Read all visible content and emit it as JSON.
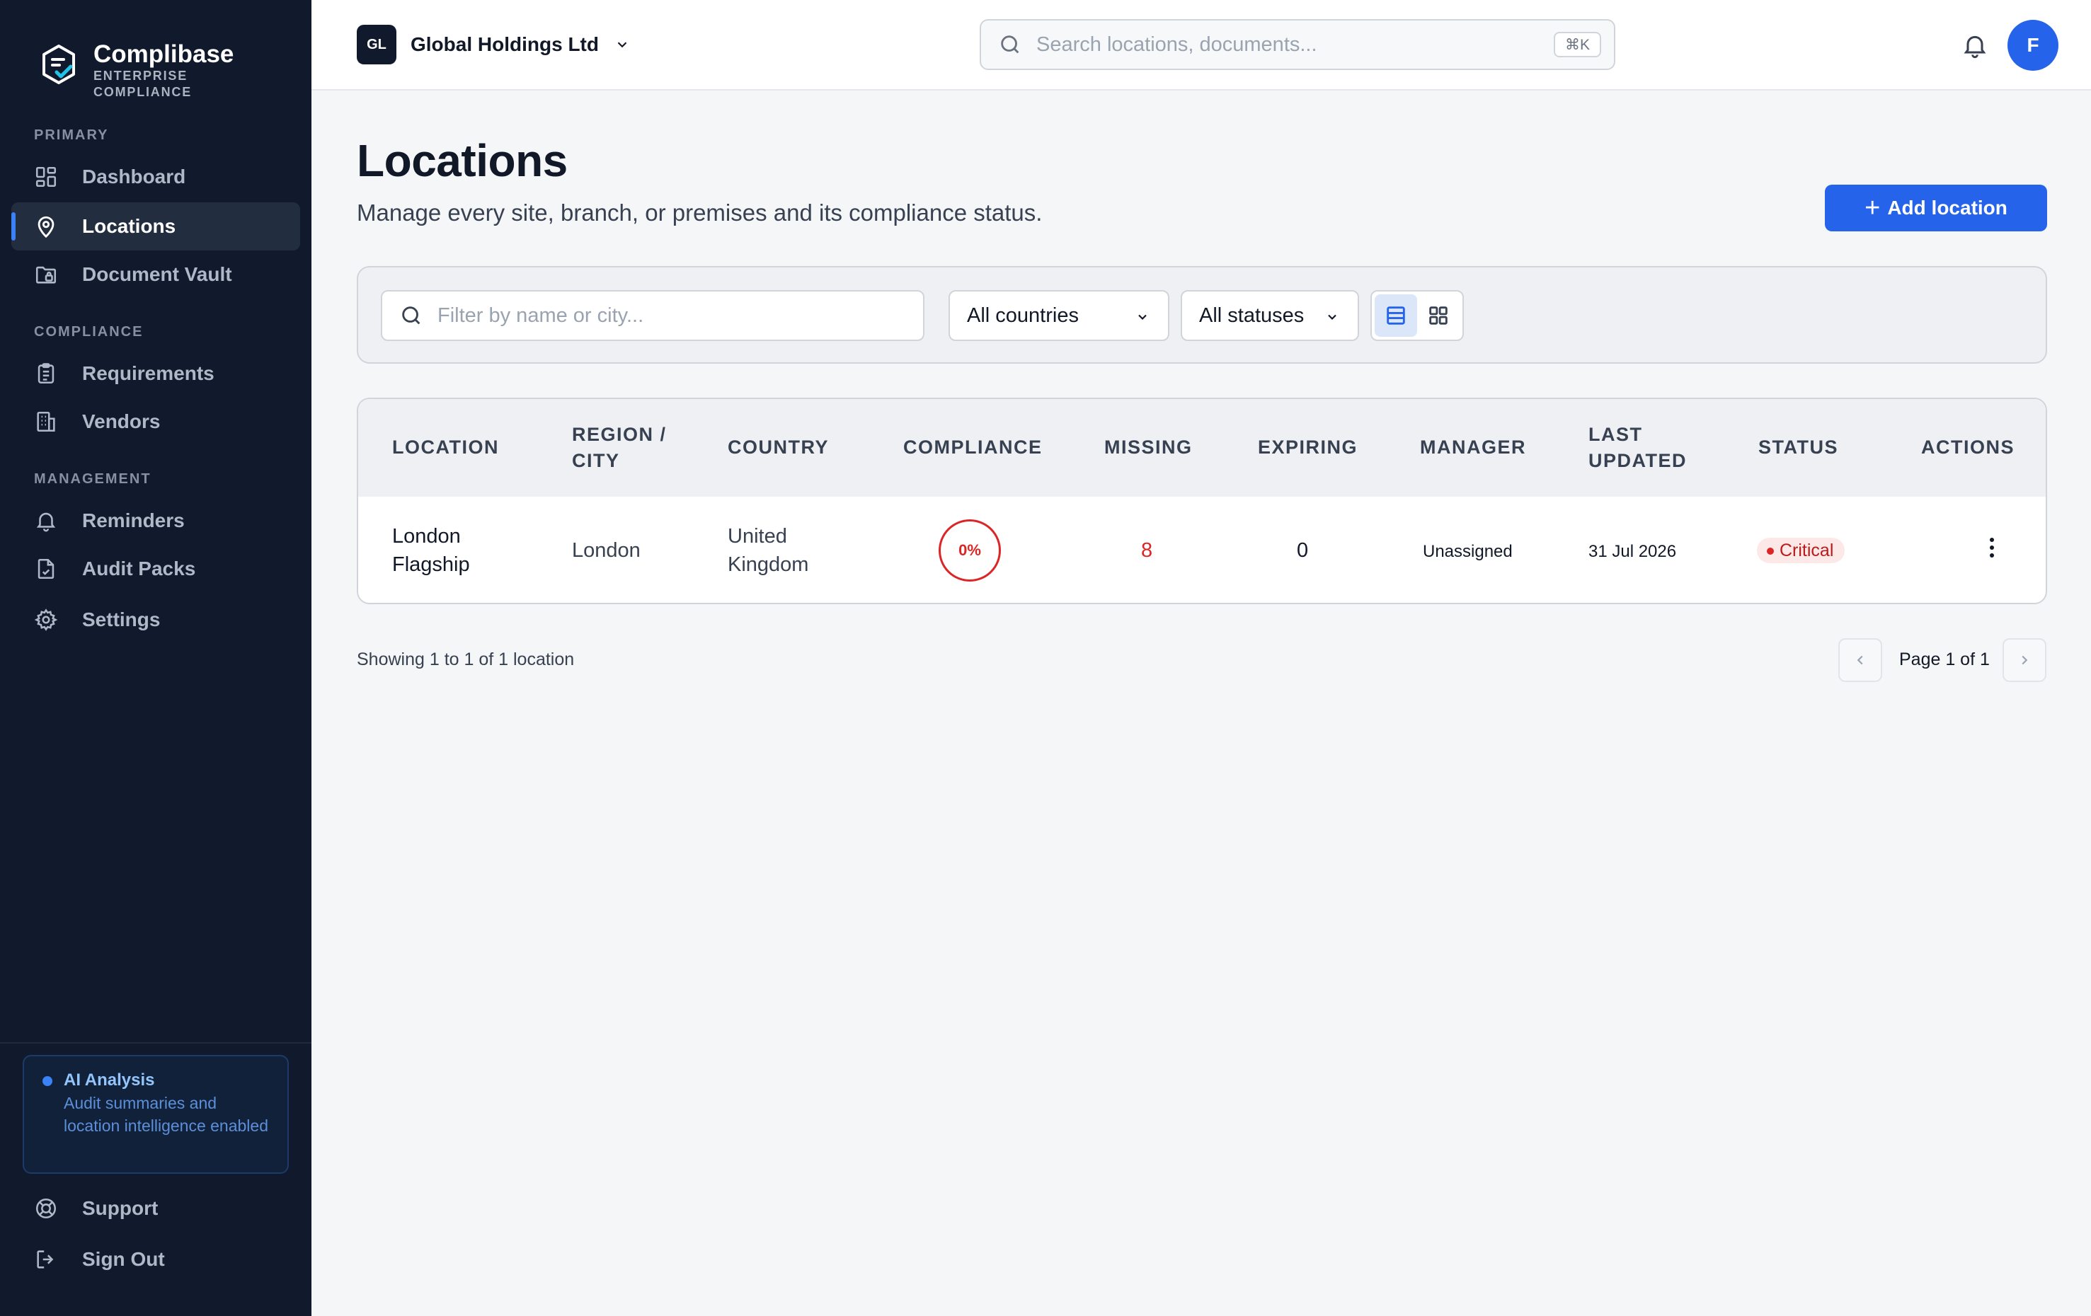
{
  "brand": {
    "name": "Complibase",
    "sub_line1": "ENTERPRISE",
    "sub_line2": "COMPLIANCE"
  },
  "sidebar": {
    "sections": {
      "primary": "PRIMARY",
      "compliance": "COMPLIANCE",
      "management": "MANAGEMENT"
    },
    "items": [
      {
        "label": "Dashboard",
        "icon": "grid-icon"
      },
      {
        "label": "Locations",
        "icon": "map-pin-icon",
        "active": true
      },
      {
        "label": "Document Vault",
        "icon": "folder-lock-icon"
      },
      {
        "label": "Requirements",
        "icon": "clipboard-icon"
      },
      {
        "label": "Vendors",
        "icon": "building-icon"
      },
      {
        "label": "Reminders",
        "icon": "bell-icon"
      },
      {
        "label": "Audit Packs",
        "icon": "file-icon"
      },
      {
        "label": "Settings",
        "icon": "gear-icon"
      }
    ],
    "ai_card": {
      "title": "AI Analysis",
      "description": "Audit summaries and location intelligence enabled"
    },
    "footer": [
      {
        "label": "Support",
        "icon": "lifebuoy-icon"
      },
      {
        "label": "Sign Out",
        "icon": "sign-out-icon"
      }
    ]
  },
  "topbar": {
    "org_initials": "GL",
    "org_name": "Global Holdings Ltd",
    "search_placeholder": "Search locations, documents...",
    "shortcut": "⌘K",
    "avatar_initial": "F"
  },
  "page": {
    "title": "Locations",
    "subtitle": "Manage every site, branch, or premises and its compliance status.",
    "add_button": "Add location"
  },
  "filters": {
    "search_placeholder": "Filter by name or city...",
    "country": "All countries",
    "status": "All statuses",
    "view": "table"
  },
  "table": {
    "headers": {
      "location": "LOCATION",
      "region": "REGION / CITY",
      "country": "COUNTRY",
      "compliance": "COMPLIANCE",
      "missing": "MISSING",
      "expiring": "EXPIRING",
      "manager": "MANAGER",
      "updated": "LAST UPDATED",
      "status": "STATUS",
      "actions": "ACTIONS"
    },
    "rows": [
      {
        "location": "London Flagship",
        "region": "London",
        "country": "United Kingdom",
        "compliance": "0%",
        "missing": "8",
        "expiring": "0",
        "manager": "Unassigned",
        "updated": "31 Jul 2026",
        "status": "Critical"
      }
    ]
  },
  "pagination": {
    "showing": "Showing 1 to 1 of 1 location",
    "page": "Page 1 of 1"
  },
  "colors": {
    "accent": "#2563eb",
    "sidebar": "#111a2c",
    "critical": "#dc2626"
  }
}
